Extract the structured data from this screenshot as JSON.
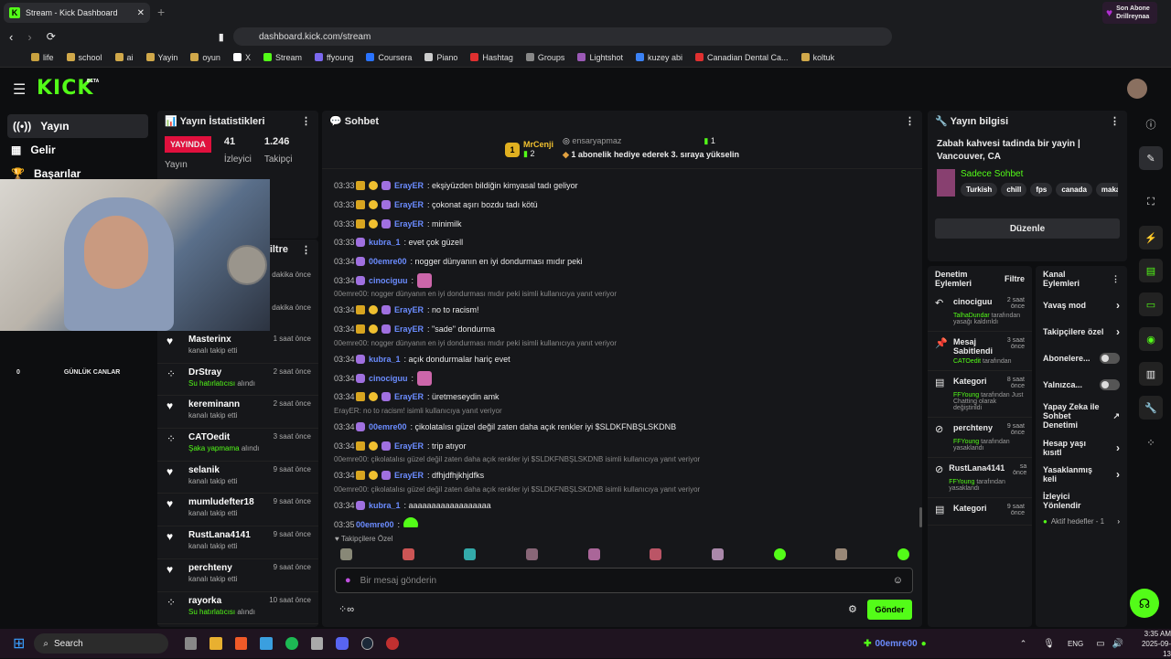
{
  "browser": {
    "tab_title": "Stream - Kick Dashboard",
    "url": "dashboard.kick.com/stream",
    "notif": {
      "line1": "Son Abone",
      "line2": "Drillreynaa"
    },
    "bookmarks": [
      "life",
      "school",
      "ai",
      "Yayin",
      "oyun",
      "X",
      "Stream",
      "ffyoung",
      "Coursera",
      "Piano",
      "Hashtag",
      "Groups",
      "Lightshot",
      "kuzey abi",
      "Canadian Dental Ca...",
      "koltuk"
    ]
  },
  "app": {
    "logo": "KICK",
    "beta": "BETA"
  },
  "sidebar": {
    "items": [
      {
        "label": "Yayın",
        "icon": "broadcast-icon"
      },
      {
        "label": "Gelir",
        "icon": "revenue-icon"
      },
      {
        "label": "Başarılar",
        "icon": "trophy-icon"
      }
    ]
  },
  "overlay": {
    "count": "0",
    "label": "GÜNLÜK CANLAR"
  },
  "stats": {
    "title": "Yayın İstatistikleri",
    "live": "YAYINDA",
    "live_sub": "Yayın",
    "viewers": "41",
    "viewers_label": "İzleyici",
    "followers": "1.246",
    "followers_label": "Takipçi"
  },
  "activity": {
    "filter": "Filtre",
    "partial_times": [
      "dakika önce",
      "dakika önce"
    ],
    "items": [
      {
        "name": "Masterinx",
        "sub": "kanalı takip etti",
        "time": "1 saat önce",
        "icon": "heart-icon"
      },
      {
        "name": "DrStray",
        "sub_green": "Su hatırlatıcısı",
        "sub": "alındı",
        "time": "2 saat önce",
        "icon": "points-icon"
      },
      {
        "name": "kereminann",
        "sub": "kanalı takip etti",
        "time": "2 saat önce",
        "icon": "heart-icon"
      },
      {
        "name": "CATOedit",
        "sub_green": "Şaka yapmama",
        "sub": "alındı",
        "time": "3 saat önce",
        "icon": "points-icon"
      },
      {
        "name": "selanik",
        "sub": "kanalı takip etti",
        "time": "9 saat önce",
        "icon": "heart-icon"
      },
      {
        "name": "mumludefter18",
        "sub": "kanalı takip etti",
        "time": "9 saat önce",
        "icon": "heart-icon"
      },
      {
        "name": "RustLana4141",
        "sub": "kanalı takip etti",
        "time": "9 saat önce",
        "icon": "heart-icon"
      },
      {
        "name": "perchteny",
        "sub": "kanalı takip etti",
        "time": "9 saat önce",
        "icon": "heart-icon"
      },
      {
        "name": "rayorka",
        "sub_green": "Su hatırlatıcısı",
        "sub": "alındı",
        "time": "10 saat önce",
        "icon": "points-icon"
      }
    ]
  },
  "chat": {
    "title": "Sohbet",
    "pinned": {
      "user": "MrCenji",
      "rank": "1",
      "count": "2",
      "gifter": "ensaryapmaz",
      "gift_count": "1",
      "text": "1 abonelik hediye ederek 3. sıraya yükselin"
    },
    "messages": [
      {
        "t": "03:33",
        "u": "ErayER",
        "m": ": ekşiyüzden bildiğin kimyasal tadı geliyor",
        "b": 3
      },
      {
        "t": "03:33",
        "u": "ErayER",
        "m": ": çokonat aşırı bozdu tadı kötü",
        "b": 3
      },
      {
        "t": "03:33",
        "u": "ErayER",
        "m": ": minimilk",
        "b": 3
      },
      {
        "t": "03:33",
        "u": "kubra_1",
        "m": ": evet çok güzell",
        "b": 1
      },
      {
        "t": "03:34",
        "u": "00emre00",
        "m": ": nogger dünyanın en iyi dondurması mıdır peki",
        "b": 1
      },
      {
        "t": "03:34",
        "u": "cinociguu",
        "m": ":",
        "b": 1,
        "emote": true
      },
      {
        "reply": "00emre00: nogger dünyanın en iyi dondurması mıdır peki isimli kullanıcıya yanıt veriyor"
      },
      {
        "t": "03:34",
        "u": "ErayER",
        "m": ": no to racism!",
        "b": 3
      },
      {
        "t": "03:34",
        "u": "ErayER",
        "m": ": \"sade\" dondurma",
        "b": 3
      },
      {
        "reply": "00emre00: nogger dünyanın en iyi dondurması mıdır peki isimli kullanıcıya yanıt veriyor"
      },
      {
        "t": "03:34",
        "u": "kubra_1",
        "m": ": açık dondurmalar hariç evet",
        "b": 1
      },
      {
        "t": "03:34",
        "u": "cinociguu",
        "m": ":",
        "b": 1,
        "emote": true
      },
      {
        "t": "03:34",
        "u": "ErayER",
        "m": ": üretmeseydin amk",
        "b": 3
      },
      {
        "reply": "ErayER: no to racism! isimli kullanıcıya yanıt veriyor"
      },
      {
        "t": "03:34",
        "u": "00emre00",
        "m": ": çikolatalısı güzel değil zaten daha açık renkler iyi $SLDKFNBŞLSKDNB",
        "b": 1
      },
      {
        "t": "03:34",
        "u": "ErayER",
        "m": ": trip atıyor",
        "b": 3
      },
      {
        "reply": "00emre00: çikolatalısı güzel değil zaten daha açık renkler iyi $SLDKFNBŞLSKDNB isimli kullanıcıya yanıt veriyor"
      },
      {
        "t": "03:34",
        "u": "ErayER",
        "m": ": dfhjdfhjkhjdfks",
        "b": 3
      },
      {
        "reply": "00emre00: çikolatalısı güzel değil zaten daha açık renkler iyi $SLDKFNBŞLSKDNB isimli kullanıcıya yanıt veriyor"
      },
      {
        "t": "03:34",
        "u": "kubra_1",
        "m": ": aaaaaaaaaaaaaaaaaa",
        "b": 1
      },
      {
        "t": "03:35",
        "u": "00emre00",
        "m": ":",
        "b": 0,
        "emote": true
      }
    ],
    "followers_only": "Takipçilere Özel",
    "input_placeholder": "Bir mesaj gönderin",
    "send": "Gönder"
  },
  "info": {
    "title": "Yayın bilgisi",
    "stream_title": "Zabah kahvesi tadinda bir yayin | Vancouver, CA",
    "category": "Sadece Sohbet",
    "tags": [
      "Turkish",
      "chill",
      "fps",
      "canada",
      "maka"
    ],
    "edit": "Düzenle"
  },
  "mod": {
    "title": "Denetim Eylemleri",
    "filter": "Filtre",
    "items": [
      {
        "title": "cinociguu",
        "time": "2 saat önce",
        "l1": "TalhaDundar",
        "l2": "tarafından yasağı kaldırıldı",
        "icon": "undo-icon"
      },
      {
        "title": "Mesaj Sabitlendi",
        "time": "3 saat önce",
        "l1": "CATOedit",
        "l2": "tarafından",
        "icon": "pin-icon"
      },
      {
        "title": "Kategori",
        "time": "8 saat önce",
        "l1": "FFYoung",
        "l2": "tarafından Just Chatting olarak değiştirildi",
        "icon": "category-icon"
      },
      {
        "title": "perchteny",
        "time": "9 saat önce",
        "l1": "FFYoung",
        "l2": "tarafından yasaklandı",
        "icon": "ban-icon"
      },
      {
        "title": "RustLana4141",
        "time": "sa önce",
        "l1": "FFYoung",
        "l2": "tarafından yasaklandı",
        "icon": "ban-icon"
      },
      {
        "title": "Kategori",
        "time": "9 saat önce",
        "l1": "",
        "l2": "",
        "icon": "category-icon"
      }
    ]
  },
  "channel": {
    "title": "Kanal Eylemleri",
    "items": [
      {
        "label": "Yavaş mod",
        "ctl": "arrow"
      },
      {
        "label": "Takipçilere özel",
        "ctl": "arrow"
      },
      {
        "label": "Abonelere...",
        "ctl": "toggle"
      },
      {
        "label": "Yalnızca...",
        "ctl": "toggle"
      },
      {
        "label": "Yapay Zeka ile Sohbet Denetimi",
        "ctl": "ext"
      },
      {
        "label": "Hesap yaşı kısıtl",
        "ctl": "arrow"
      },
      {
        "label": "Yasaklanmış keli",
        "ctl": "arrow"
      },
      {
        "label": "İzleyici Yönlendir",
        "ctl": ""
      }
    ],
    "active_goals": "Aktif hedefler - 1"
  },
  "taskbar": {
    "search": "Search",
    "lang": "ENG",
    "time": "3:35 AM",
    "date": "2025-09-13",
    "user": "00emre00"
  },
  "colors": {
    "accent": "#53fc18",
    "live": "#e0103d",
    "username": "#6b8cff"
  }
}
